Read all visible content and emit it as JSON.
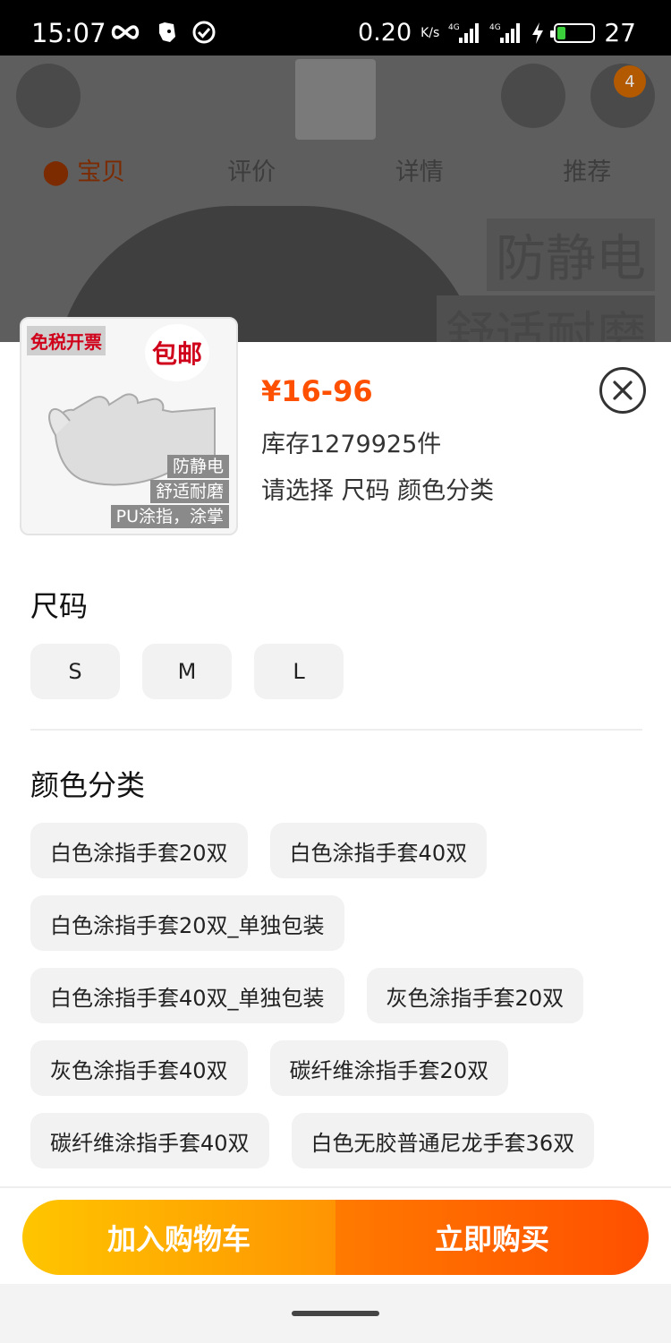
{
  "status_bar": {
    "time": "15:07",
    "net_speed": "0.20",
    "net_unit": "K/s",
    "signal1": "4G",
    "signal2": "4G",
    "battery": "27",
    "icons": [
      "infinity-icon",
      "evernote-icon",
      "check-circle-icon",
      "signal-icon",
      "charging-icon",
      "battery-icon"
    ]
  },
  "background_page": {
    "cart_badge": "4",
    "tabs": [
      "宝贝",
      "评价",
      "详情",
      "推荐"
    ],
    "banner_text": [
      "防静电",
      "舒适耐磨"
    ],
    "thumb_text": [
      "免税开票",
      "包邮"
    ]
  },
  "product": {
    "image_tags": {
      "invoice": "免税开票",
      "free_shipping": "包邮",
      "labels": [
        "防静电",
        "舒适耐磨",
        "PU涂指，涂掌"
      ]
    },
    "price": "¥16-96",
    "stock": "库存1279925件",
    "select_hint": "请选择 尺码 颜色分类"
  },
  "size": {
    "title": "尺码",
    "options": [
      "S",
      "M",
      "L"
    ]
  },
  "color": {
    "title": "颜色分类",
    "options": [
      "白色涂指手套20双",
      "白色涂指手套40双",
      "白色涂指手套20双_单独包装",
      "白色涂指手套40双_单独包装",
      "灰色涂指手套20双",
      "灰色涂指手套40双",
      "碳纤维涂指手套20双",
      "碳纤维涂指手套40双",
      "白色无胶普通尼龙手套36双"
    ]
  },
  "actions": {
    "add_to_cart": "加入购物车",
    "buy_now": "立即购买"
  },
  "colors": {
    "price": "#ff5000",
    "cart_gradient": [
      "#ffc500",
      "#ff9402"
    ],
    "buy_gradient": [
      "#ff7a00",
      "#ff4f00"
    ],
    "option_bg": "#f2f2f2"
  }
}
